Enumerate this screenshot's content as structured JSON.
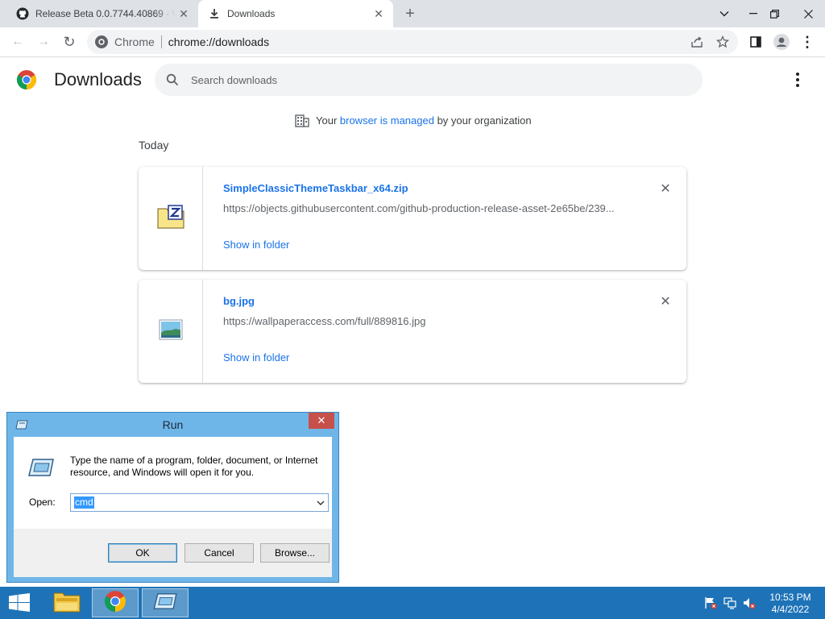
{
  "tabs": [
    {
      "title": "Release Beta 0.0.7744.40869 · Wi",
      "close": "✕"
    },
    {
      "title": "Downloads",
      "close": "✕"
    }
  ],
  "new_tab": "+",
  "window_controls": {
    "dropdown": "⌄",
    "minimize": "—",
    "restore": "❐",
    "close": "✕"
  },
  "toolbar": {
    "back": "←",
    "forward": "→",
    "reload": "↻",
    "site_name": "Chrome",
    "url": "chrome://downloads",
    "menu": "⋮"
  },
  "downloads": {
    "title": "Downloads",
    "search_placeholder": "Search downloads",
    "managed_prefix": "Your ",
    "managed_link": "browser is managed",
    "managed_suffix": " by your organization",
    "group_label": "Today",
    "items": [
      {
        "name": "SimpleClassicThemeTaskbar_x64.zip",
        "url": "https://objects.githubusercontent.com/github-production-release-asset-2e65be/239...",
        "action": "Show in folder",
        "close": "✕",
        "icon": "zip-archive-icon"
      },
      {
        "name": "bg.jpg",
        "url": "https://wallpaperaccess.com/full/889816.jpg",
        "action": "Show in folder",
        "close": "✕",
        "icon": "image-file-icon"
      }
    ]
  },
  "run_dialog": {
    "title": "Run",
    "close": "✕",
    "description": "Type the name of a program, folder, document, or Internet resource, and Windows will open it for you.",
    "open_label": "Open:",
    "open_value": "cmd",
    "ok": "OK",
    "cancel": "Cancel",
    "browse": "Browse..."
  },
  "taskbar": {
    "time": "10:53 PM",
    "date": "4/4/2022",
    "items": [
      "file-explorer-icon",
      "chrome-icon",
      "run-icon"
    ]
  },
  "colors": {
    "link": "#1a73e8",
    "taskbar": "#1e73b8",
    "run_frame": "#6fb6e8",
    "run_close": "#c7504a"
  }
}
